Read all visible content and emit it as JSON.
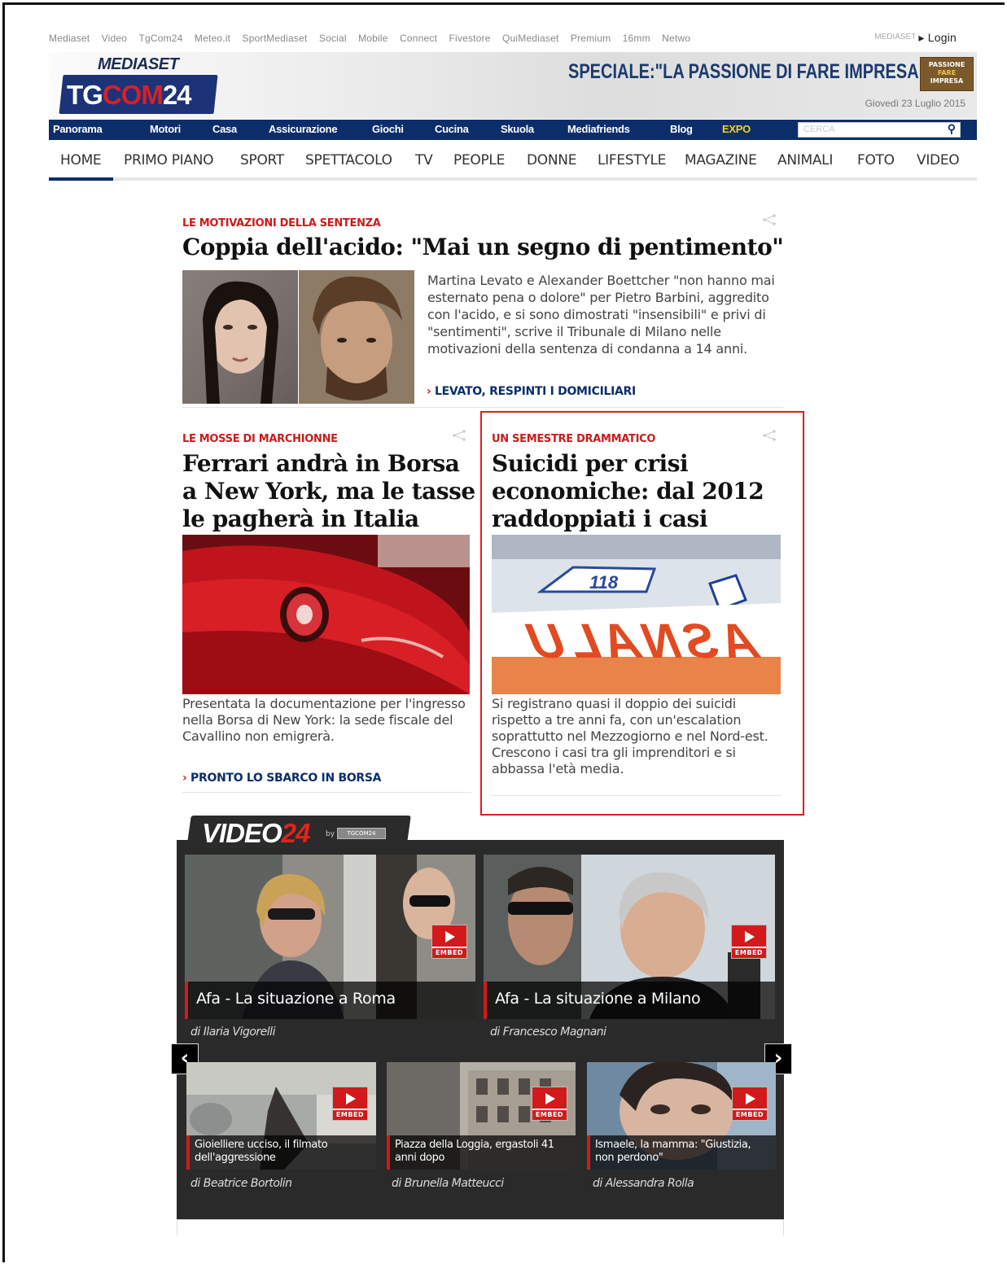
{
  "network_bar": {
    "links": [
      "Mediaset",
      "Video",
      "TgCom24",
      "Meteo.it",
      "SportMediaset",
      "Social",
      "Mobile",
      "Connect",
      "Fivestore",
      "QuiMediaset",
      "Premium",
      "16mm",
      "Netwo"
    ],
    "mediaset_it": "MEDIASET.it",
    "login": "▸ Login"
  },
  "header": {
    "logo_top": "MEDIASET",
    "logo_left": "TG",
    "logo_red": "COM",
    "logo_right": "24",
    "speciale": "SPECIALE:\"LA PASSIONE DI FARE IMPRESA\"",
    "badge_lines": [
      "PASSIONE",
      "FARE",
      "IMPRESA"
    ],
    "date": "Giovedì 23 Luglio 2015"
  },
  "blue_nav": {
    "items": [
      "Panorama",
      "Motori",
      "Casa",
      "Assicurazione",
      "Giochi",
      "Cucina",
      "Skuola",
      "Mediafriends",
      "Blog",
      "EXPO"
    ],
    "search_placeholder": "CERCA"
  },
  "section_nav": {
    "items": [
      "HOME",
      "PRIMO PIANO",
      "SPORT",
      "SPETTACOLO",
      "TV",
      "PEOPLE",
      "DONNE",
      "LIFESTYLE",
      "MAGAZINE",
      "ANIMALI",
      "FOTO",
      "VIDEO"
    ],
    "active": "HOME"
  },
  "articles": {
    "main": {
      "kicker": "LE MOTIVAZIONI DELLA SENTENZA",
      "headline": "Coppia dell'acido: \"Mai un segno di pentimento\"",
      "summary": "Martina Levato e Alexander Boettcher \"non hanno mai esternato pena o dolore\" per Pietro Barbini, aggredito con l'acido, e si sono dimostrati \"insensibili\" e privi di \"sentimenti\", scrive il Tribunale di Milano nelle motivazioni della sentenza di condanna a 14 anni.",
      "link": "LEVATO, RESPINTI I DOMICILIARI"
    },
    "left": {
      "kicker": "LE MOSSE DI MARCHIONNE",
      "headline": "Ferrari andrà in Borsa a New York, ma le tasse le pagherà in Italia",
      "summary": "Presentata la documentazione per l'ingresso nella Borsa di New York: la sede fiscale del Cavallino non emigrerà.",
      "link": "PRONTO LO SBARCO IN BORSA"
    },
    "right": {
      "kicker": "UN SEMESTRE DRAMMATICO",
      "headline": "Suicidi per crisi economiche: dal 2012 raddoppiati i casi",
      "summary": "Si registrano quasi il doppio dei suicidi rispetto a tre anni fa, con un'escalation soprattutto nel Mezzogiorno e nel Nord-est. Crescono i casi tra gli imprenditori e si abbassa l'età media.",
      "image_text": "ASNALU"
    }
  },
  "video24": {
    "title_white": "VIDEO",
    "title_red": "24",
    "by": "by",
    "by_logo": "TGCOM24",
    "embed_label": "EMBED",
    "prev": "‹",
    "next": "›",
    "big": [
      {
        "caption": "Afa - La situazione a Roma",
        "author": "di Ilaria Vigorelli"
      },
      {
        "caption": "Afa - La situazione a Milano",
        "author": "di Francesco Magnani"
      }
    ],
    "small": [
      {
        "caption": "Gioielliere ucciso, il filmato dell'aggressione",
        "author": "di Beatrice Bortolin"
      },
      {
        "caption": "Piazza della Loggia, ergastoli 41 anni dopo",
        "author": "di Brunella Matteucci"
      },
      {
        "caption": "Ismaele, la mamma: \"Giustizia, non perdono\"",
        "author": "di Alessandra Rolla"
      }
    ]
  },
  "colors": {
    "brand_blue": "#0b2e6b",
    "kicker_red": "#cc1a1a",
    "highlight": "#e21d1d",
    "expo": "#f1d41c"
  }
}
